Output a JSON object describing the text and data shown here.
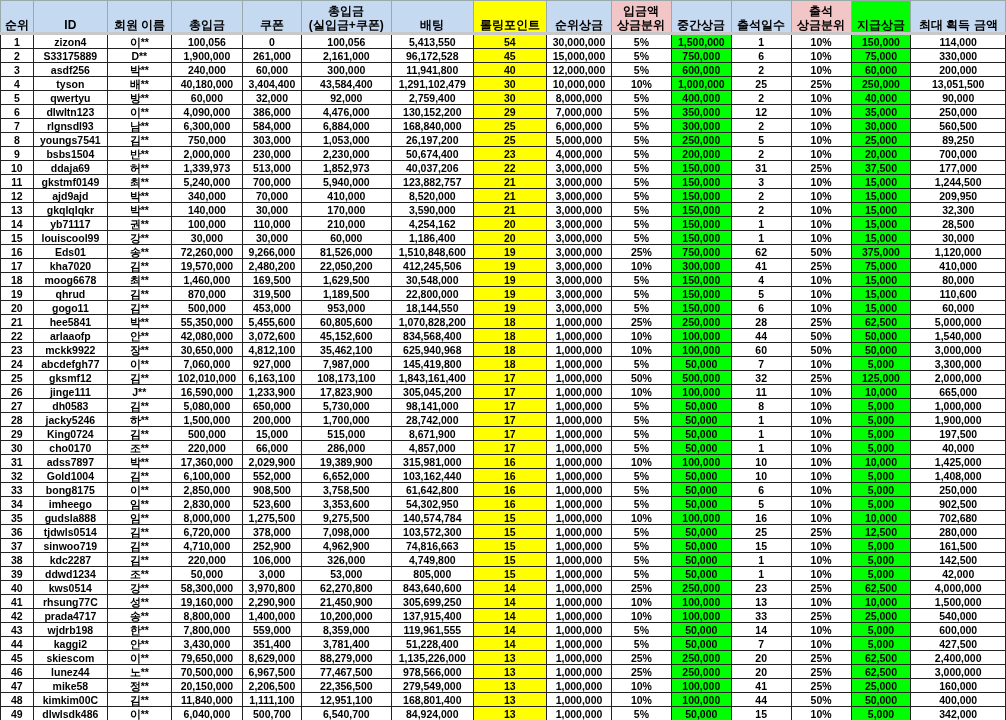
{
  "table": {
    "columns": [
      {
        "label": "순위",
        "color": "#c5d9f1"
      },
      {
        "label": "ID",
        "color": "#c5d9f1"
      },
      {
        "label": "회원 이름",
        "color": "#c5d9f1"
      },
      {
        "label": "총입금",
        "color": "#c5d9f1"
      },
      {
        "label": "쿠폰",
        "color": "#c5d9f1"
      },
      {
        "label": "총입금\n(실입금+쿠폰)",
        "color": "#c5d9f1"
      },
      {
        "label": "배팅",
        "color": "#c5d9f1"
      },
      {
        "label": "롤링포인트",
        "color": "#ffff00",
        "cells": {
          "color": "#ffff00"
        }
      },
      {
        "label": "순위상금",
        "color": "#c5d9f1"
      },
      {
        "label": "입금액\n상금분위",
        "color": "#f2c6c6"
      },
      {
        "label": "중간상금",
        "color": "#c5d9f1",
        "cells": {
          "color": "#00ff00"
        }
      },
      {
        "label": "출석일수",
        "color": "#c5d9f1"
      },
      {
        "label": "출석\n상금분위",
        "color": "#f2c6c6"
      },
      {
        "label": "지급상금",
        "color": "#00ff00",
        "cells": {
          "color": "#00ff00"
        }
      },
      {
        "label": "최대 획득 금액",
        "color": "#c5d9f1"
      }
    ],
    "rows": [
      [
        "1",
        "zizon4",
        "이**",
        "100,056",
        "0",
        "100,056",
        "5,413,550",
        "54",
        "30,000,000",
        "5%",
        "1,500,000",
        "1",
        "10%",
        "150,000",
        "114,000"
      ],
      [
        "2",
        "S33175889",
        "D**",
        "1,900,000",
        "261,000",
        "2,161,000",
        "96,172,528",
        "45",
        "15,000,000",
        "5%",
        "750,000",
        "6",
        "10%",
        "75,000",
        "330,000"
      ],
      [
        "3",
        "asdf256",
        "박**",
        "240,000",
        "60,000",
        "300,000",
        "11,941,800",
        "40",
        "12,000,000",
        "5%",
        "600,000",
        "2",
        "10%",
        "60,000",
        "200,000"
      ],
      [
        "4",
        "tyson",
        "배**",
        "40,180,000",
        "3,404,400",
        "43,584,400",
        "1,291,102,479",
        "30",
        "10,000,000",
        "10%",
        "1,000,000",
        "25",
        "25%",
        "250,000",
        "13,051,500"
      ],
      [
        "5",
        "qwertyu",
        "방**",
        "60,000",
        "32,000",
        "92,000",
        "2,759,400",
        "30",
        "8,000,000",
        "5%",
        "400,000",
        "2",
        "10%",
        "40,000",
        "90,000"
      ],
      [
        "6",
        "dlwltn123",
        "이**",
        "4,090,000",
        "386,000",
        "4,476,000",
        "130,152,200",
        "29",
        "7,000,000",
        "5%",
        "350,000",
        "12",
        "10%",
        "35,000",
        "250,000"
      ],
      [
        "7",
        "rlgnsdl93",
        "남**",
        "6,300,000",
        "584,000",
        "6,884,000",
        "168,840,000",
        "25",
        "6,000,000",
        "5%",
        "300,000",
        "2",
        "10%",
        "30,000",
        "560,500"
      ],
      [
        "8",
        "youngs7541",
        "김**",
        "750,000",
        "303,000",
        "1,053,000",
        "26,197,200",
        "25",
        "5,000,000",
        "5%",
        "250,000",
        "5",
        "10%",
        "25,000",
        "89,250"
      ],
      [
        "9",
        "bsbs1504",
        "반**",
        "2,000,000",
        "230,000",
        "2,230,000",
        "50,674,400",
        "23",
        "4,000,000",
        "5%",
        "200,000",
        "2",
        "10%",
        "20,000",
        "700,000"
      ],
      [
        "10",
        "ddaja69",
        "허**",
        "1,339,973",
        "513,000",
        "1,852,973",
        "40,037,206",
        "22",
        "3,000,000",
        "5%",
        "150,000",
        "31",
        "25%",
        "37,500",
        "177,000"
      ],
      [
        "11",
        "gkstmf0149",
        "최**",
        "5,240,000",
        "700,000",
        "5,940,000",
        "123,882,757",
        "21",
        "3,000,000",
        "5%",
        "150,000",
        "3",
        "10%",
        "15,000",
        "1,244,500"
      ],
      [
        "12",
        "ajd9ajd",
        "박**",
        "340,000",
        "70,000",
        "410,000",
        "8,520,000",
        "21",
        "3,000,000",
        "5%",
        "150,000",
        "2",
        "10%",
        "15,000",
        "209,950"
      ],
      [
        "13",
        "gkqlqlqkr",
        "박**",
        "140,000",
        "30,000",
        "170,000",
        "3,590,000",
        "21",
        "3,000,000",
        "5%",
        "150,000",
        "2",
        "10%",
        "15,000",
        "32,300"
      ],
      [
        "14",
        "yb71117",
        "권**",
        "100,000",
        "110,000",
        "210,000",
        "4,254,162",
        "20",
        "3,000,000",
        "5%",
        "150,000",
        "1",
        "10%",
        "15,000",
        "28,500"
      ],
      [
        "15",
        "louiscool99",
        "강**",
        "30,000",
        "30,000",
        "60,000",
        "1,186,400",
        "20",
        "3,000,000",
        "5%",
        "150,000",
        "1",
        "10%",
        "15,000",
        "30,000"
      ],
      [
        "16",
        "Eds01",
        "송**",
        "72,260,000",
        "9,266,000",
        "81,526,000",
        "1,510,848,600",
        "19",
        "3,000,000",
        "25%",
        "750,000",
        "62",
        "50%",
        "375,000",
        "1,120,000"
      ],
      [
        "17",
        "kha7020",
        "김**",
        "19,570,000",
        "2,480,200",
        "22,050,200",
        "412,245,506",
        "19",
        "3,000,000",
        "10%",
        "300,000",
        "41",
        "25%",
        "75,000",
        "410,000"
      ],
      [
        "18",
        "moog6678",
        "최**",
        "1,460,000",
        "169,500",
        "1,629,500",
        "30,548,000",
        "19",
        "3,000,000",
        "5%",
        "150,000",
        "4",
        "10%",
        "15,000",
        "80,000"
      ],
      [
        "19",
        "qhrud",
        "김**",
        "870,000",
        "319,500",
        "1,189,500",
        "22,800,000",
        "19",
        "3,000,000",
        "5%",
        "150,000",
        "5",
        "10%",
        "15,000",
        "110,600"
      ],
      [
        "20",
        "gogo11",
        "김**",
        "500,000",
        "453,000",
        "953,000",
        "18,144,550",
        "19",
        "3,000,000",
        "5%",
        "150,000",
        "6",
        "10%",
        "15,000",
        "60,000"
      ],
      [
        "21",
        "hee5841",
        "박**",
        "55,350,000",
        "5,455,600",
        "60,805,600",
        "1,070,828,200",
        "18",
        "1,000,000",
        "25%",
        "250,000",
        "28",
        "25%",
        "62,500",
        "5,000,000"
      ],
      [
        "22",
        "arlaaofp",
        "안**",
        "42,080,000",
        "3,072,600",
        "45,152,600",
        "834,568,400",
        "18",
        "1,000,000",
        "10%",
        "100,000",
        "44",
        "50%",
        "50,000",
        "1,540,000"
      ],
      [
        "23",
        "mckk9922",
        "장**",
        "30,650,000",
        "4,812,100",
        "35,462,100",
        "625,940,968",
        "18",
        "1,000,000",
        "10%",
        "100,000",
        "60",
        "50%",
        "50,000",
        "3,000,000"
      ],
      [
        "24",
        "abcdefgh77",
        "이**",
        "7,060,000",
        "927,000",
        "7,987,000",
        "145,419,800",
        "18",
        "1,000,000",
        "5%",
        "50,000",
        "7",
        "10%",
        "5,000",
        "3,300,000"
      ],
      [
        "25",
        "gksmf12",
        "김**",
        "102,010,000",
        "6,163,100",
        "108,173,100",
        "1,843,161,400",
        "17",
        "1,000,000",
        "50%",
        "500,000",
        "32",
        "25%",
        "125,000",
        "2,000,000"
      ],
      [
        "26",
        "jinge111",
        "J**",
        "16,590,000",
        "1,233,900",
        "17,823,900",
        "305,045,200",
        "17",
        "1,000,000",
        "10%",
        "100,000",
        "11",
        "10%",
        "10,000",
        "665,000"
      ],
      [
        "27",
        "dh0583",
        "김**",
        "5,080,000",
        "650,000",
        "5,730,000",
        "98,141,000",
        "17",
        "1,000,000",
        "5%",
        "50,000",
        "8",
        "10%",
        "5,000",
        "1,000,000"
      ],
      [
        "28",
        "jacky5246",
        "하**",
        "1,500,000",
        "200,000",
        "1,700,000",
        "28,742,000",
        "17",
        "1,000,000",
        "5%",
        "50,000",
        "1",
        "10%",
        "5,000",
        "1,900,000"
      ],
      [
        "29",
        "King0724",
        "김**",
        "500,000",
        "15,000",
        "515,000",
        "8,671,900",
        "17",
        "1,000,000",
        "5%",
        "50,000",
        "1",
        "10%",
        "5,000",
        "197,500"
      ],
      [
        "30",
        "cho0170",
        "조**",
        "220,000",
        "66,000",
        "286,000",
        "4,857,000",
        "17",
        "1,000,000",
        "5%",
        "50,000",
        "1",
        "10%",
        "5,000",
        "40,000"
      ],
      [
        "31",
        "adss7897",
        "박**",
        "17,360,000",
        "2,029,900",
        "19,389,900",
        "315,981,000",
        "16",
        "1,000,000",
        "10%",
        "100,000",
        "10",
        "10%",
        "10,000",
        "1,425,000"
      ],
      [
        "32",
        "Gold1004",
        "김**",
        "6,100,000",
        "552,000",
        "6,652,000",
        "103,162,440",
        "16",
        "1,000,000",
        "5%",
        "50,000",
        "10",
        "10%",
        "5,000",
        "1,408,000"
      ],
      [
        "33",
        "bong8175",
        "이**",
        "2,850,000",
        "908,500",
        "3,758,500",
        "61,642,800",
        "16",
        "1,000,000",
        "5%",
        "50,000",
        "6",
        "10%",
        "5,000",
        "250,000"
      ],
      [
        "34",
        "imheego",
        "임**",
        "2,830,000",
        "523,600",
        "3,353,600",
        "54,302,950",
        "16",
        "1,000,000",
        "5%",
        "50,000",
        "5",
        "10%",
        "5,000",
        "902,500"
      ],
      [
        "35",
        "gudsla888",
        "임**",
        "8,000,000",
        "1,275,500",
        "9,275,500",
        "140,574,784",
        "15",
        "1,000,000",
        "10%",
        "100,000",
        "16",
        "10%",
        "10,000",
        "702,680"
      ],
      [
        "36",
        "tjdwls0514",
        "김**",
        "6,720,000",
        "378,000",
        "7,098,000",
        "103,572,300",
        "15",
        "1,000,000",
        "5%",
        "50,000",
        "25",
        "25%",
        "12,500",
        "280,000"
      ],
      [
        "37",
        "sinwoo719",
        "김**",
        "4,710,000",
        "252,900",
        "4,962,900",
        "74,816,663",
        "15",
        "1,000,000",
        "5%",
        "50,000",
        "15",
        "10%",
        "5,000",
        "161,500"
      ],
      [
        "38",
        "kdc2287",
        "김**",
        "220,000",
        "106,000",
        "326,000",
        "4,749,800",
        "15",
        "1,000,000",
        "5%",
        "50,000",
        "1",
        "10%",
        "5,000",
        "142,500"
      ],
      [
        "39",
        "ddwd1234",
        "조**",
        "50,000",
        "3,000",
        "53,000",
        "805,000",
        "15",
        "1,000,000",
        "5%",
        "50,000",
        "1",
        "10%",
        "5,000",
        "42,000"
      ],
      [
        "40",
        "kws0514",
        "강**",
        "58,300,000",
        "3,970,800",
        "62,270,800",
        "843,640,600",
        "14",
        "1,000,000",
        "25%",
        "250,000",
        "23",
        "25%",
        "62,500",
        "4,000,000"
      ],
      [
        "41",
        "rhsung77C",
        "성**",
        "19,160,000",
        "2,290,900",
        "21,450,900",
        "305,699,250",
        "14",
        "1,000,000",
        "10%",
        "100,000",
        "13",
        "10%",
        "10,000",
        "1,500,000"
      ],
      [
        "42",
        "prada4717",
        "송**",
        "8,800,000",
        "1,400,000",
        "10,200,000",
        "137,915,400",
        "14",
        "1,000,000",
        "10%",
        "100,000",
        "33",
        "25%",
        "25,000",
        "540,000"
      ],
      [
        "43",
        "wjdrb198",
        "한**",
        "7,800,000",
        "559,000",
        "8,359,000",
        "119,961,555",
        "14",
        "1,000,000",
        "5%",
        "50,000",
        "14",
        "10%",
        "5,000",
        "600,000"
      ],
      [
        "44",
        "kaggi2",
        "안**",
        "3,430,000",
        "351,400",
        "3,781,400",
        "51,228,400",
        "14",
        "1,000,000",
        "5%",
        "50,000",
        "7",
        "10%",
        "5,000",
        "427,500"
      ],
      [
        "45",
        "skiescom",
        "이**",
        "79,650,000",
        "8,629,000",
        "88,279,000",
        "1,135,226,000",
        "13",
        "1,000,000",
        "25%",
        "250,000",
        "20",
        "25%",
        "62,500",
        "2,400,000"
      ],
      [
        "46",
        "lunez44",
        "노**",
        "70,500,000",
        "6,967,500",
        "77,467,500",
        "978,566,000",
        "13",
        "1,000,000",
        "25%",
        "250,000",
        "20",
        "25%",
        "62,500",
        "3,000,000"
      ],
      [
        "47",
        "mike58",
        "정**",
        "20,150,000",
        "2,206,500",
        "22,356,500",
        "279,549,000",
        "13",
        "1,000,000",
        "10%",
        "100,000",
        "41",
        "25%",
        "25,000",
        "160,000"
      ],
      [
        "48",
        "kimkim00C",
        "김**",
        "11,840,000",
        "1,111,100",
        "12,951,100",
        "168,801,400",
        "13",
        "1,000,000",
        "10%",
        "100,000",
        "44",
        "50%",
        "50,000",
        "400,000"
      ],
      [
        "49",
        "dlwlsdk486",
        "이**",
        "6,040,000",
        "500,700",
        "6,540,700",
        "84,924,000",
        "13",
        "1,000,000",
        "5%",
        "50,000",
        "15",
        "10%",
        "5,000",
        "342,000"
      ]
    ]
  }
}
